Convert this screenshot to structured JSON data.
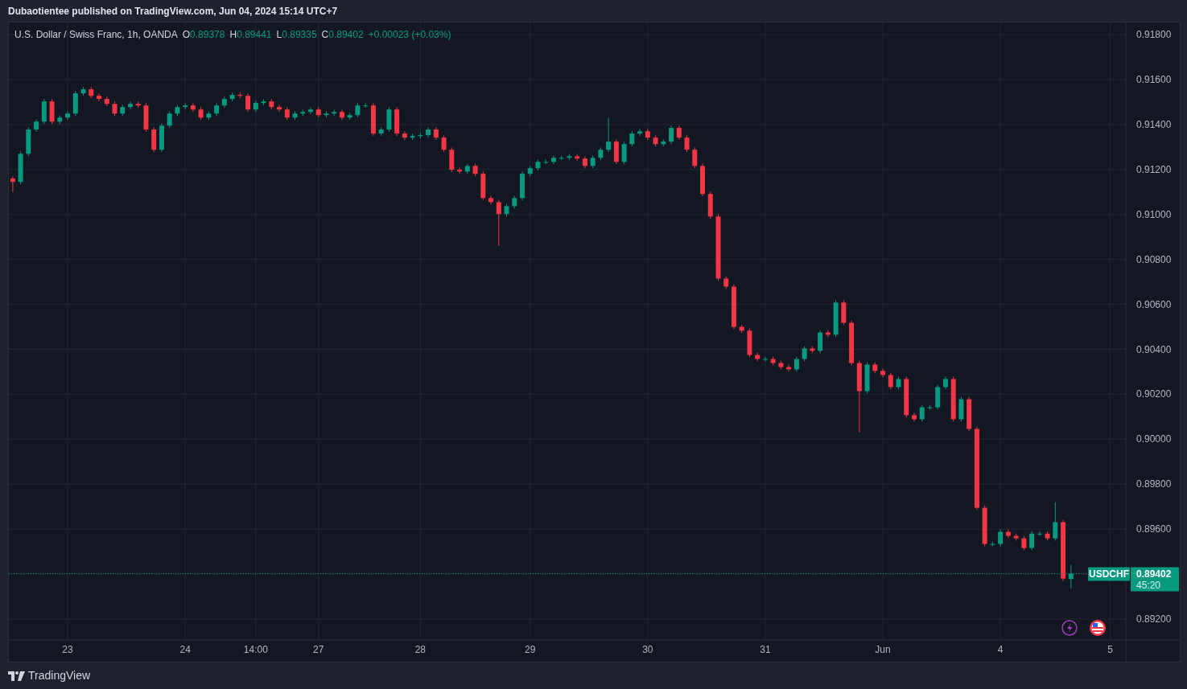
{
  "header": {
    "text": "Dubaotientee published on TradingView.com, Jun 04, 2024 15:14 UTC+7"
  },
  "legend": {
    "symbol": "U.S. Dollar / Swiss Franc, 1h, OANDA",
    "values": [
      {
        "label": "O",
        "value": "0.89378"
      },
      {
        "label": "H",
        "value": "0.89441"
      },
      {
        "label": "L",
        "value": "0.89335"
      },
      {
        "label": "C",
        "value": "0.89402"
      }
    ],
    "change": "+0.00023 (+0.03%)"
  },
  "chart_data": {
    "type": "candlestick",
    "grid": true,
    "ylim": [
      0.89107,
      0.91854
    ],
    "categories": [
      null,
      null,
      null,
      null,
      null,
      null,
      null,
      "23",
      null,
      null,
      null,
      null,
      null,
      null,
      null,
      null,
      null,
      null,
      null,
      null,
      null,
      null,
      "24",
      null,
      null,
      null,
      null,
      null,
      null,
      null,
      null,
      "14:00",
      null,
      null,
      null,
      null,
      null,
      null,
      null,
      "27",
      null,
      null,
      null,
      null,
      null,
      null,
      null,
      null,
      null,
      null,
      null,
      null,
      "28",
      null,
      null,
      null,
      null,
      null,
      null,
      null,
      null,
      null,
      null,
      null,
      null,
      null,
      "29",
      null,
      null,
      null,
      null,
      null,
      null,
      null,
      null,
      null,
      null,
      null,
      null,
      null,
      null,
      "30",
      null,
      null,
      null,
      null,
      null,
      null,
      null,
      null,
      null,
      null,
      null,
      null,
      null,
      null,
      "31",
      null,
      null,
      null,
      null,
      null,
      null,
      null,
      null,
      null,
      null,
      null,
      null,
      null,
      null,
      "Jun",
      null,
      null,
      null,
      null,
      null,
      null,
      null,
      null,
      null,
      null,
      null,
      null,
      null,
      null,
      "4",
      null,
      null,
      null,
      null,
      null,
      null,
      null,
      null,
      null,
      null,
      null,
      null,
      null,
      "5"
    ],
    "yticks": [
      {
        "value": 0.918,
        "label": "0.91800"
      },
      {
        "value": 0.916,
        "label": "0.91600"
      },
      {
        "value": 0.914,
        "label": "0.91400"
      },
      {
        "value": 0.912,
        "label": "0.91200"
      },
      {
        "value": 0.91,
        "label": "0.91000"
      },
      {
        "value": 0.908,
        "label": "0.90800"
      },
      {
        "value": 0.906,
        "label": "0.90600"
      },
      {
        "value": 0.904,
        "label": "0.90400"
      },
      {
        "value": 0.902,
        "label": "0.90200"
      },
      {
        "value": 0.9,
        "label": "0.90000"
      },
      {
        "value": 0.898,
        "label": "0.89800"
      },
      {
        "value": 0.896,
        "label": "0.89600"
      },
      {
        "value": 0.892,
        "label": "0.89200"
      }
    ],
    "ref_lines": [
      {
        "axis": "y",
        "value": 0.89402,
        "label": "0.89402"
      }
    ],
    "ohlc": [
      [
        0.9116,
        0.9117,
        0.911,
        0.91145
      ],
      [
        0.91145,
        0.9128,
        0.91135,
        0.9127
      ],
      [
        0.9127,
        0.91388,
        0.9126,
        0.91378
      ],
      [
        0.91378,
        0.91423,
        0.91368,
        0.91413
      ],
      [
        0.91413,
        0.91513,
        0.91403,
        0.91503
      ],
      [
        0.91503,
        0.91513,
        0.91403,
        0.91413
      ],
      [
        0.91413,
        0.91441,
        0.91403,
        0.91431
      ],
      [
        0.91431,
        0.91459,
        0.91421,
        0.91449
      ],
      [
        0.91449,
        0.91549,
        0.91439,
        0.91539
      ],
      [
        0.91539,
        0.91567,
        0.91529,
        0.91557
      ],
      [
        0.91557,
        0.91567,
        0.91518,
        0.91528
      ],
      [
        0.91528,
        0.91538,
        0.91504,
        0.91514
      ],
      [
        0.91514,
        0.91524,
        0.91482,
        0.91492
      ],
      [
        0.91492,
        0.91502,
        0.91439,
        0.91449
      ],
      [
        0.91449,
        0.91488,
        0.91439,
        0.91478
      ],
      [
        0.91478,
        0.91502,
        0.91468,
        0.91492
      ],
      [
        0.91492,
        0.91502,
        0.91475,
        0.91485
      ],
      [
        0.91485,
        0.91495,
        0.91368,
        0.91378
      ],
      [
        0.91378,
        0.91388,
        0.91278,
        0.91288
      ],
      [
        0.91288,
        0.91405,
        0.91278,
        0.91395
      ],
      [
        0.91395,
        0.91459,
        0.91385,
        0.91449
      ],
      [
        0.91449,
        0.91488,
        0.91439,
        0.91478
      ],
      [
        0.91478,
        0.91495,
        0.91468,
        0.91485
      ],
      [
        0.91485,
        0.91495,
        0.91457,
        0.91467
      ],
      [
        0.91467,
        0.91477,
        0.91421,
        0.91431
      ],
      [
        0.91431,
        0.91459,
        0.91421,
        0.91449
      ],
      [
        0.91449,
        0.91495,
        0.91439,
        0.91485
      ],
      [
        0.91485,
        0.91524,
        0.91475,
        0.91514
      ],
      [
        0.91514,
        0.91542,
        0.91504,
        0.91532
      ],
      [
        0.91532,
        0.91542,
        0.91518,
        0.91528
      ],
      [
        0.91528,
        0.91538,
        0.91457,
        0.91467
      ],
      [
        0.91467,
        0.91506,
        0.91457,
        0.91496
      ],
      [
        0.91496,
        0.91513,
        0.91486,
        0.91503
      ],
      [
        0.91503,
        0.91513,
        0.91468,
        0.91478
      ],
      [
        0.91478,
        0.91488,
        0.91457,
        0.91467
      ],
      [
        0.91467,
        0.91477,
        0.91421,
        0.91431
      ],
      [
        0.91431,
        0.91459,
        0.91421,
        0.91449
      ],
      [
        0.91449,
        0.91466,
        0.91439,
        0.91456
      ],
      [
        0.91456,
        0.91477,
        0.91446,
        0.91467
      ],
      [
        0.91467,
        0.91477,
        0.91432,
        0.91442
      ],
      [
        0.91442,
        0.91459,
        0.91432,
        0.91449
      ],
      [
        0.91449,
        0.91466,
        0.91439,
        0.91456
      ],
      [
        0.91456,
        0.91466,
        0.91421,
        0.91431
      ],
      [
        0.91431,
        0.91452,
        0.91421,
        0.91442
      ],
      [
        0.91442,
        0.91495,
        0.91432,
        0.91485
      ],
      [
        0.91485,
        0.91495,
        0.91475,
        0.91485
      ],
      [
        0.91485,
        0.91495,
        0.9135,
        0.9136
      ],
      [
        0.9136,
        0.91388,
        0.9135,
        0.91378
      ],
      [
        0.91378,
        0.91477,
        0.91368,
        0.91467
      ],
      [
        0.91467,
        0.91477,
        0.9135,
        0.9136
      ],
      [
        0.9136,
        0.9137,
        0.91332,
        0.91342
      ],
      [
        0.91342,
        0.91359,
        0.91332,
        0.91349
      ],
      [
        0.91349,
        0.91363,
        0.91339,
        0.91353
      ],
      [
        0.91353,
        0.91388,
        0.91343,
        0.91378
      ],
      [
        0.91378,
        0.91388,
        0.91332,
        0.91342
      ],
      [
        0.91342,
        0.91352,
        0.91278,
        0.91288
      ],
      [
        0.91288,
        0.91298,
        0.91189,
        0.91199
      ],
      [
        0.91199,
        0.91209,
        0.91181,
        0.91191
      ],
      [
        0.91191,
        0.91226,
        0.91181,
        0.91216
      ],
      [
        0.91216,
        0.91226,
        0.91171,
        0.91181
      ],
      [
        0.91181,
        0.91191,
        0.91063,
        0.91073
      ],
      [
        0.91073,
        0.91083,
        0.91045,
        0.91055
      ],
      [
        0.91055,
        0.91065,
        0.9086,
        0.91002
      ],
      [
        0.91002,
        0.91047,
        0.90992,
        0.91037
      ],
      [
        0.91037,
        0.91083,
        0.91027,
        0.91073
      ],
      [
        0.91073,
        0.91191,
        0.91063,
        0.91181
      ],
      [
        0.91181,
        0.91216,
        0.91171,
        0.91206
      ],
      [
        0.91206,
        0.91244,
        0.91196,
        0.91234
      ],
      [
        0.91234,
        0.91244,
        0.91224,
        0.91234
      ],
      [
        0.91234,
        0.91262,
        0.91224,
        0.91252
      ],
      [
        0.91252,
        0.91262,
        0.91242,
        0.91252
      ],
      [
        0.91252,
        0.91269,
        0.91242,
        0.91259
      ],
      [
        0.91259,
        0.91269,
        0.91239,
        0.91249
      ],
      [
        0.91249,
        0.91259,
        0.91206,
        0.91216
      ],
      [
        0.91216,
        0.91262,
        0.91206,
        0.91252
      ],
      [
        0.91252,
        0.91298,
        0.91242,
        0.91288
      ],
      [
        0.91288,
        0.9143,
        0.91278,
        0.91324
      ],
      [
        0.91324,
        0.91334,
        0.91224,
        0.91234
      ],
      [
        0.91234,
        0.91323,
        0.91224,
        0.91313
      ],
      [
        0.91313,
        0.9137,
        0.91303,
        0.9136
      ],
      [
        0.9136,
        0.9138,
        0.9135,
        0.9137
      ],
      [
        0.9137,
        0.9138,
        0.91332,
        0.91342
      ],
      [
        0.91342,
        0.91352,
        0.91303,
        0.91313
      ],
      [
        0.91313,
        0.91334,
        0.91303,
        0.91324
      ],
      [
        0.91324,
        0.91395,
        0.91314,
        0.91385
      ],
      [
        0.91385,
        0.91395,
        0.91332,
        0.91342
      ],
      [
        0.91342,
        0.91352,
        0.91278,
        0.91288
      ],
      [
        0.91288,
        0.91298,
        0.91206,
        0.91216
      ],
      [
        0.91216,
        0.91226,
        0.91081,
        0.91091
      ],
      [
        0.91091,
        0.91101,
        0.90981,
        0.90991
      ],
      [
        0.90991,
        0.91001,
        0.90705,
        0.90715
      ],
      [
        0.90715,
        0.90725,
        0.90669,
        0.90679
      ],
      [
        0.90679,
        0.90689,
        0.9049,
        0.905
      ],
      [
        0.905,
        0.9051,
        0.90473,
        0.90483
      ],
      [
        0.90483,
        0.90493,
        0.90365,
        0.90375
      ],
      [
        0.90375,
        0.90385,
        0.90347,
        0.90357
      ],
      [
        0.90357,
        0.90367,
        0.90347,
        0.90357
      ],
      [
        0.90357,
        0.90367,
        0.90329,
        0.90339
      ],
      [
        0.90339,
        0.90349,
        0.90311,
        0.90321
      ],
      [
        0.90321,
        0.90331,
        0.90301,
        0.90311
      ],
      [
        0.90311,
        0.90367,
        0.90301,
        0.90357
      ],
      [
        0.90357,
        0.90414,
        0.90347,
        0.90404
      ],
      [
        0.90404,
        0.90414,
        0.90383,
        0.90393
      ],
      [
        0.90393,
        0.90485,
        0.90383,
        0.90475
      ],
      [
        0.90475,
        0.90485,
        0.90455,
        0.90465
      ],
      [
        0.90465,
        0.90618,
        0.90455,
        0.90608
      ],
      [
        0.90608,
        0.90618,
        0.90508,
        0.90518
      ],
      [
        0.90518,
        0.90528,
        0.90329,
        0.90339
      ],
      [
        0.90339,
        0.90349,
        0.9003,
        0.90214
      ],
      [
        0.90214,
        0.90342,
        0.90204,
        0.90332
      ],
      [
        0.90332,
        0.90342,
        0.90294,
        0.90304
      ],
      [
        0.90304,
        0.90314,
        0.90276,
        0.90286
      ],
      [
        0.90286,
        0.90296,
        0.90222,
        0.90232
      ],
      [
        0.90232,
        0.90278,
        0.90222,
        0.90268
      ],
      [
        0.90268,
        0.90278,
        0.90097,
        0.90107
      ],
      [
        0.90107,
        0.90117,
        0.90079,
        0.90089
      ],
      [
        0.90089,
        0.90152,
        0.90079,
        0.90142
      ],
      [
        0.90142,
        0.90152,
        0.90132,
        0.90142
      ],
      [
        0.90142,
        0.90242,
        0.90132,
        0.90232
      ],
      [
        0.90232,
        0.90278,
        0.90222,
        0.90268
      ],
      [
        0.90268,
        0.90278,
        0.90079,
        0.90089
      ],
      [
        0.90089,
        0.90188,
        0.90079,
        0.90178
      ],
      [
        0.90178,
        0.90188,
        0.90036,
        0.90046
      ],
      [
        0.90046,
        0.90056,
        0.89685,
        0.89695
      ],
      [
        0.89695,
        0.89705,
        0.89524,
        0.89534
      ],
      [
        0.89534,
        0.89544,
        0.89524,
        0.89534
      ],
      [
        0.89534,
        0.89598,
        0.89524,
        0.89588
      ],
      [
        0.89588,
        0.89598,
        0.8956,
        0.8957
      ],
      [
        0.8957,
        0.8958,
        0.89549,
        0.89559
      ],
      [
        0.89559,
        0.89569,
        0.89506,
        0.89516
      ],
      [
        0.89516,
        0.8959,
        0.89506,
        0.8958
      ],
      [
        0.8958,
        0.8959,
        0.8957,
        0.8958
      ],
      [
        0.8958,
        0.8959,
        0.89549,
        0.89559
      ],
      [
        0.89559,
        0.8972,
        0.89549,
        0.89631
      ],
      [
        0.89631,
        0.89641,
        0.8937,
        0.8938
      ],
      [
        0.89378,
        0.89441,
        0.89335,
        0.89402
      ],
      null,
      null,
      null,
      null,
      null
    ]
  },
  "price_label": {
    "symbol": "USDCHF",
    "countdown": "45:20"
  },
  "footer": {
    "brand": "TradingView"
  }
}
